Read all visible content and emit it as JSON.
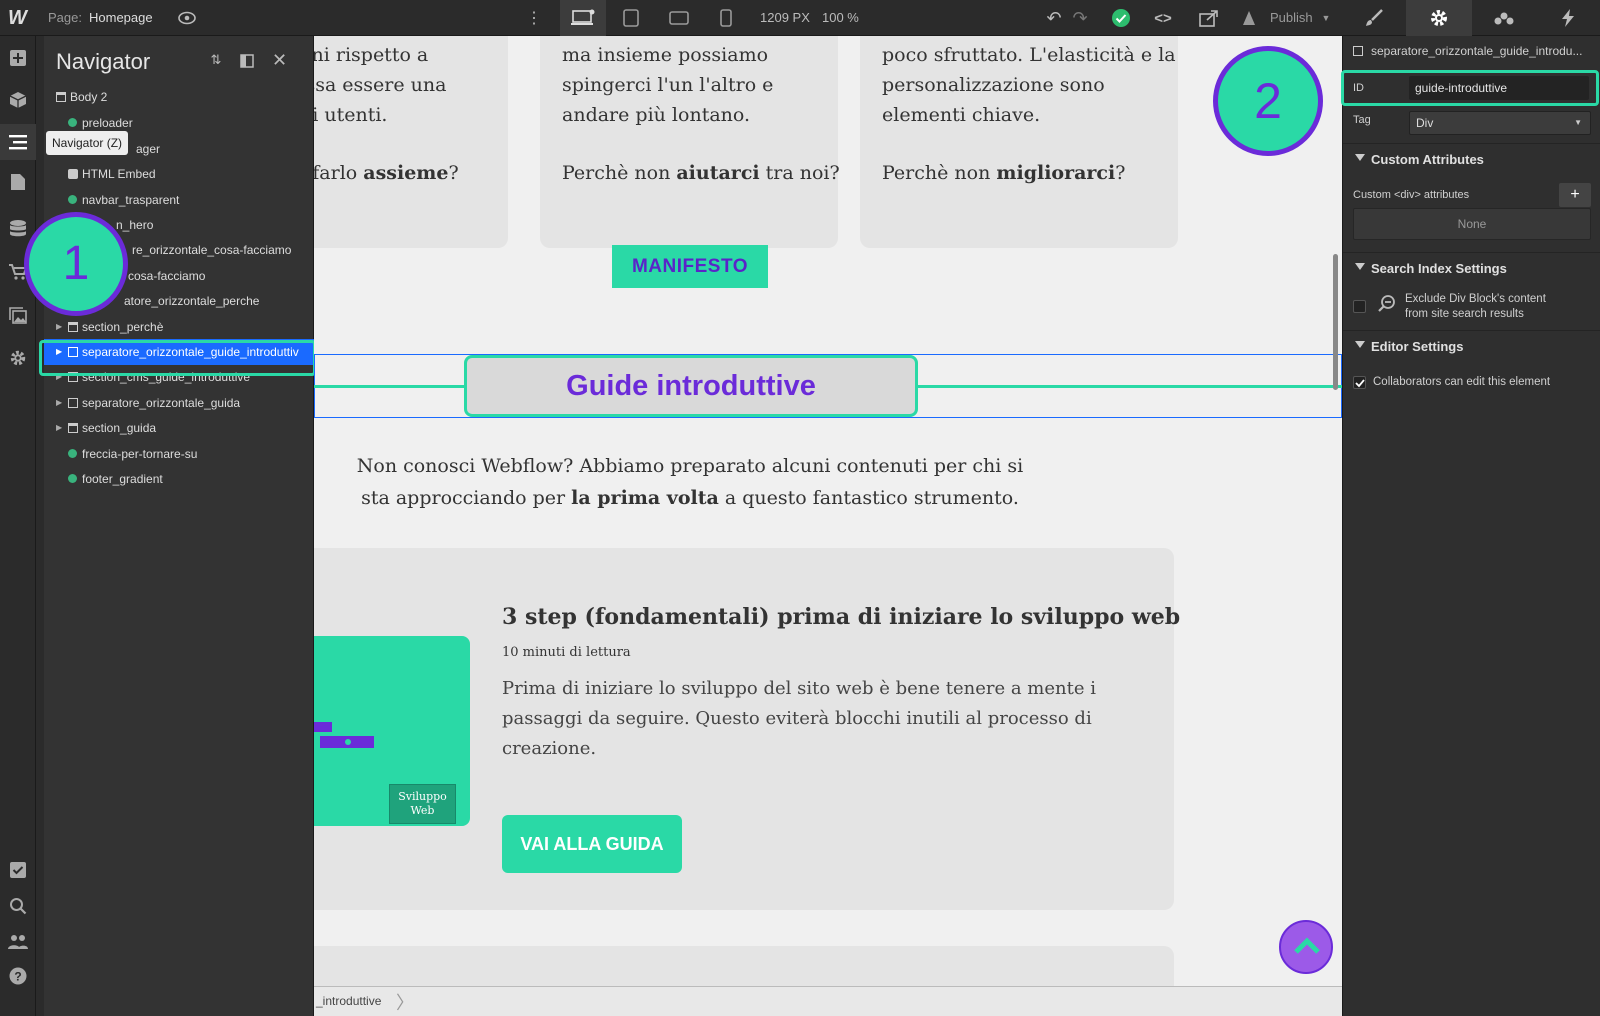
{
  "topbar": {
    "logo": "W",
    "page_label": "Page:",
    "page_name": "Homepage",
    "width_readout": "1209 PX",
    "zoom_readout": "100 %",
    "publish_label": "Publish"
  },
  "tooltip": {
    "navigator": "Navigator (Z)"
  },
  "navigator": {
    "title": "Navigator",
    "items": [
      {
        "label": "Body 2"
      },
      {
        "label": "preloader"
      },
      {
        "label": "ager"
      },
      {
        "label": "HTML Embed"
      },
      {
        "label": "navbar_trasparent"
      },
      {
        "label": "n_hero"
      },
      {
        "label": "re_orizzontale_cosa-facciamo"
      },
      {
        "label": "cosa-facciamo"
      },
      {
        "label": "atore_orizzontale_perche"
      },
      {
        "label": "section_perchè"
      },
      {
        "label": "separatore_orizzontale_guide_introduttiv"
      },
      {
        "label": "section_cms_guide_introduttive"
      },
      {
        "label": "separatore_orizzontale_guida"
      },
      {
        "label": "section_guida"
      },
      {
        "label": "freccia-per-tornare-su"
      },
      {
        "label": "footer_gradient"
      }
    ]
  },
  "annotations": {
    "one": "1",
    "two": "2"
  },
  "canvas": {
    "card1_lines": [
      "ioni rispetto a",
      "ossa essere una",
      "gli utenti."
    ],
    "card1_q_pre": "n farlo ",
    "card1_q_bold": "assieme",
    "card1_q_post": "?",
    "card2_lines": [
      "ma insieme possiamo",
      "spingerci l'un l'altro e",
      "andare più lontano."
    ],
    "card2_q_pre": "Perchè non ",
    "card2_q_bold": "aiutarci",
    "card2_q_post": " tra noi?",
    "card3_lines": [
      "poco sfruttato. L'elasticità e la",
      "personalizzazione sono",
      "elementi chiave."
    ],
    "card3_q_pre": "Perchè non ",
    "card3_q_bold": "migliorarci",
    "card3_q_post": "?",
    "manifesto_button": "MANIFESTO",
    "separator_title": "Guide introduttive",
    "intro_line1": "Non conosci Webflow? Abbiamo preparato alcuni contenuti per chi si",
    "intro_line2_pre": "sta approcciando per ",
    "intro_line2_bold": "la prima volta",
    "intro_line2_post": " a questo fantastico strumento.",
    "guide_title": "3 step (fondamentali) prima di iniziare lo sviluppo web",
    "guide_meta": "10 minuti di lettura",
    "guide_desc": [
      "Prima di iniziare lo sviluppo del sito web è bene tenere a mente i",
      "passaggi da seguire. Questo eviterà blocchi inutili al processo di",
      "creazione."
    ],
    "guide_tag": [
      "Sviluppo",
      "Web"
    ],
    "guide_button": "VAI ALLA GUIDA"
  },
  "breadcrumb": {
    "text": "_introduttive"
  },
  "panel": {
    "element_name": "separatore_orizzontale_guide_introdu...",
    "id_label": "ID",
    "id_value": "guide-introduttive",
    "tag_label": "Tag",
    "tag_value": "Div",
    "custom_attributes_title": "Custom Attributes",
    "custom_div_label": "Custom <div> attributes",
    "none_label": "None",
    "search_index_title": "Search Index Settings",
    "exclude_line1": "Exclude Div Block's content",
    "exclude_line2": "from site search results",
    "editor_settings_title": "Editor Settings",
    "collaborators_label": "Collaborators can edit this element"
  },
  "colors": {
    "accent_teal": "#2ad9a6",
    "accent_purple": "#6b2bd9",
    "selection_blue": "#1a6aff",
    "panel_bg": "#2f2f2f"
  }
}
